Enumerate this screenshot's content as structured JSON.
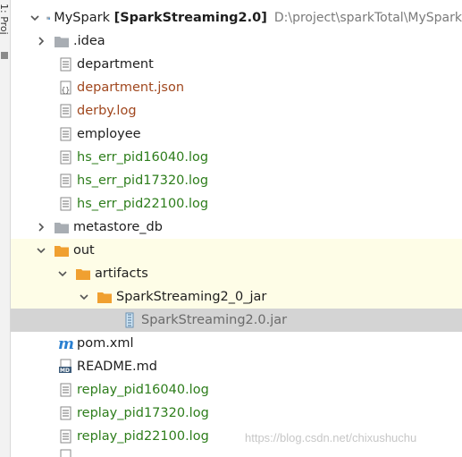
{
  "sidebar": {
    "vertical_text": "1: Proj"
  },
  "root": {
    "name": "MySpark",
    "module": "[SparkStreaming2.0]",
    "path": "D:\\project\\sparkTotal\\MySpark"
  },
  "items": [
    {
      "label": "idea_folder",
      "text": ".idea"
    },
    {
      "text": "department"
    },
    {
      "text": "department.json"
    },
    {
      "text": "derby.log"
    },
    {
      "text": "employee"
    },
    {
      "text": "hs_err_pid16040.log"
    },
    {
      "text": "hs_err_pid17320.log"
    },
    {
      "text": "hs_err_pid22100.log"
    },
    {
      "text": "metastore_db"
    },
    {
      "text": "out"
    },
    {
      "text": "artifacts"
    },
    {
      "text": "SparkStreaming2_0_jar"
    },
    {
      "text": "SparkStreaming2.0.jar"
    },
    {
      "text": "pom.xml"
    },
    {
      "text": "README.md"
    },
    {
      "text": "replay_pid16040.log"
    },
    {
      "text": "replay_pid17320.log"
    },
    {
      "text": "replay_pid22100.log"
    }
  ],
  "watermark": "https://blog.csdn.net/chixushuchu",
  "colors": {
    "folder_orange": "#f0a030",
    "folder_gray": "#a8adb3",
    "green_text": "#2d7d1b",
    "brown_text": "#a0471e"
  }
}
